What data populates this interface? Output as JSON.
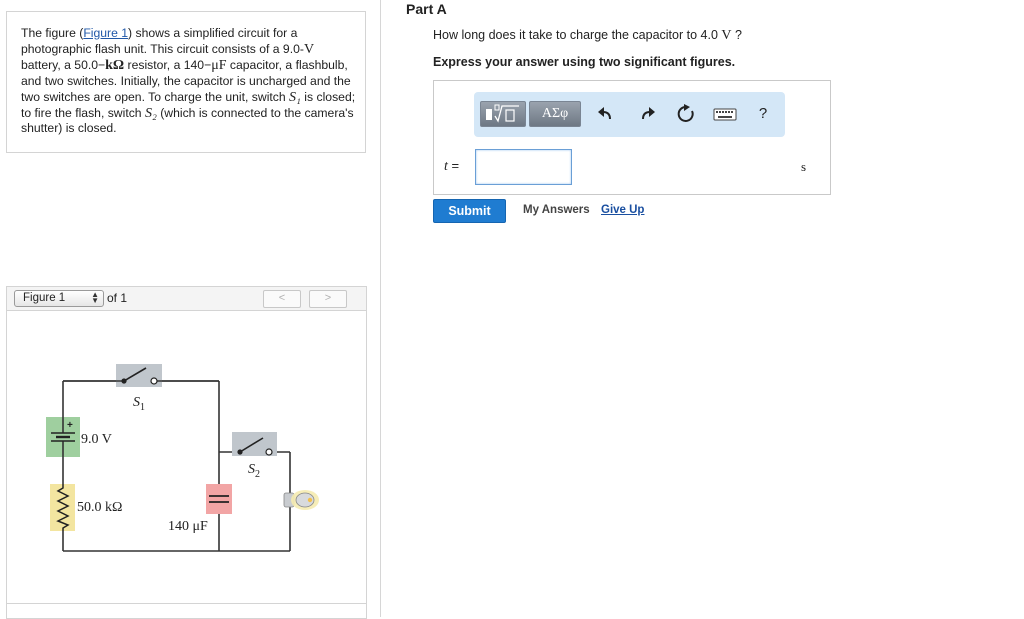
{
  "problem": {
    "intro": "The figure (",
    "figure_link": "Figure 1",
    "p1": ") shows a simplified circuit for a photographic flash unit. This circuit consists of a 9.0-",
    "unit_V": "V",
    "p2": " battery, a 50.0−",
    "unit_kohm": "kΩ",
    "p3": " resistor, a 140−",
    "unit_uF": "μF",
    "p4": " capacitor, a flashbulb, and two switches. Initially, the capacitor is uncharged and the two switches are open. To charge the unit, switch ",
    "s1": "S₁",
    "p5": " is closed; to fire the flash, switch ",
    "s2": "S₂",
    "p6": " (which is connected to the camera's shutter) is closed."
  },
  "figure_nav": {
    "select_value": "Figure 1",
    "of_text": "of 1",
    "prev_icon": "chevron-left-icon",
    "next_icon": "chevron-right-icon"
  },
  "circuit": {
    "s1_label": "S",
    "s1_sub": "1",
    "s2_label": "S",
    "s2_sub": "2",
    "battery_label": "9.0 V",
    "battery_plus": "+",
    "resistor_label": "50.0 kΩ",
    "capacitor_label": "140 μF"
  },
  "part": {
    "title": "Part A",
    "question_pre": "How long does it take to charge the capacitor to 4.0 ",
    "question_unit": "V",
    "question_post": " ?",
    "instruction": "Express your answer using two significant figures."
  },
  "toolbar": {
    "template_icon": "template-icon",
    "greek_label": "ΑΣφ",
    "undo_icon": "undo-icon",
    "redo_icon": "redo-icon",
    "reset_icon": "reset-icon",
    "keyboard_icon": "keyboard-icon",
    "help_label": "?"
  },
  "answer": {
    "var": "t",
    "eq": " =",
    "value": "",
    "units": "s"
  },
  "actions": {
    "submit": "Submit",
    "my_answers": "My Answers",
    "give_up": "Give Up"
  },
  "colors": {
    "submit_bg": "#1f7cd1",
    "toolbar_bg": "#d4e7f7",
    "link": "#2158a8",
    "switch_bg": "#c0c6cc",
    "battery_bg": "#9fcf9f",
    "resistor_bg": "#f3e5a0",
    "capacitor_bg": "#f2a5a5"
  }
}
